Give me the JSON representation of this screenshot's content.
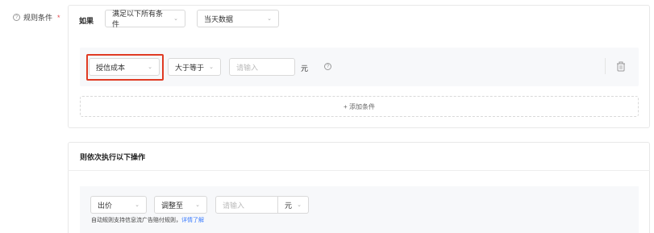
{
  "rule": {
    "label": "规则条件",
    "required_mark": "*",
    "help_glyph": "?"
  },
  "conditions": {
    "if_label": "如果",
    "match_select": "满足以下所有条件",
    "data_scope_select": "当天数据",
    "row": {
      "field_select": "授信成本",
      "operator_select": "大于等于",
      "value_placeholder": "请输入",
      "unit": "元"
    },
    "add_condition_label": "+ 添加条件",
    "highlight_color": "#e03b24"
  },
  "actions": {
    "title": "则依次执行以下操作",
    "action_select": "出价",
    "mode_select": "调整至",
    "value_placeholder": "请输入",
    "unit_select": "元",
    "note_text": "自动规则支持信息流广告赔付规则，",
    "note_link": "详情了解",
    "link_color": "#3b7cff"
  }
}
